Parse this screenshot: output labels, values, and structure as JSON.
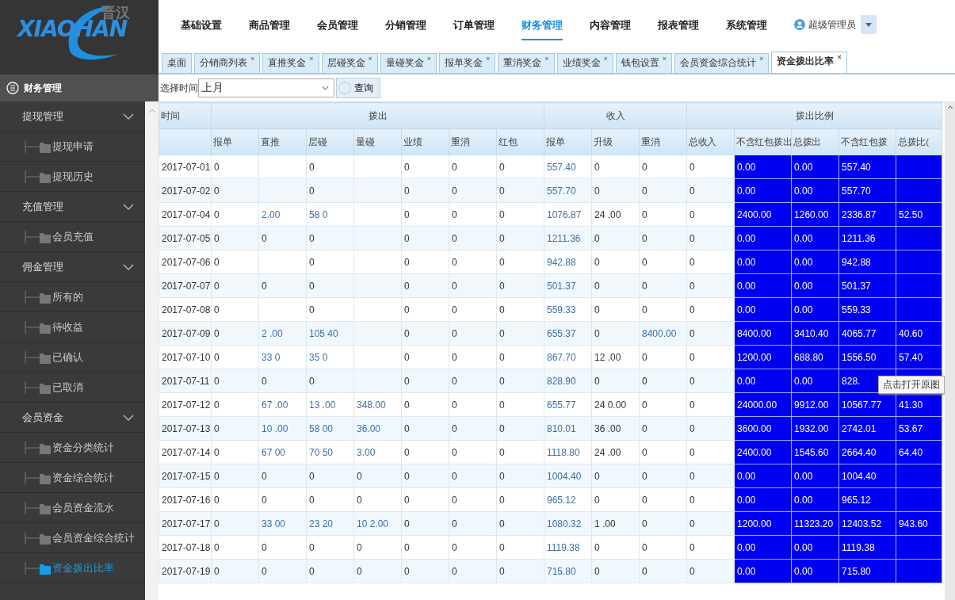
{
  "logo": {
    "text": "XIAOHAN",
    "subtext": "晋汉"
  },
  "nav": [
    {
      "label": "基础设置",
      "selected": false
    },
    {
      "label": "商品管理",
      "selected": false
    },
    {
      "label": "会员管理",
      "selected": false
    },
    {
      "label": "分销管理",
      "selected": false
    },
    {
      "label": "订单管理",
      "selected": false
    },
    {
      "label": "财务管理",
      "selected": true
    },
    {
      "label": "内容管理",
      "selected": false
    },
    {
      "label": "报表管理",
      "selected": false
    },
    {
      "label": "系统管理",
      "selected": false
    }
  ],
  "user": {
    "name": "超级管理员"
  },
  "tabs": [
    {
      "label": "桌面",
      "selected": false
    },
    {
      "label": "分销商列表",
      "close": "×",
      "selected": false
    },
    {
      "label": "直推奖金",
      "close": "×",
      "selected": false
    },
    {
      "label": "层碰奖金",
      "close": "×",
      "selected": false
    },
    {
      "label": "量碰奖金",
      "close": "×",
      "selected": false
    },
    {
      "label": "报单奖金",
      "close": "×",
      "selected": false
    },
    {
      "label": "重消奖金",
      "close": "×",
      "selected": false
    },
    {
      "label": "业绩奖金",
      "close": "×",
      "selected": false
    },
    {
      "label": "钱包设置",
      "close": "×",
      "selected": false
    },
    {
      "label": "会员资金综合统计",
      "close": "×",
      "selected": false
    },
    {
      "label": "资金拨出比率",
      "close": "×",
      "selected": true
    }
  ],
  "sidebar": {
    "title": "财务管理",
    "groups": [
      {
        "label": "提现管理",
        "expanded": true,
        "children": [
          {
            "label": "提现申请",
            "selected": false
          },
          {
            "label": "提现历史",
            "selected": false
          }
        ]
      },
      {
        "label": "充值管理",
        "expanded": true,
        "children": [
          {
            "label": "会员充值",
            "selected": false
          }
        ]
      },
      {
        "label": "佣金管理",
        "expanded": true,
        "children": [
          {
            "label": "所有的",
            "selected": false
          },
          {
            "label": "待收益",
            "selected": false
          },
          {
            "label": "已确认",
            "selected": false
          },
          {
            "label": "已取消",
            "selected": false
          }
        ]
      },
      {
        "label": "会员资金",
        "expanded": true,
        "children": [
          {
            "label": "资金分类统计",
            "selected": false
          },
          {
            "label": "资金综合统计",
            "selected": false
          },
          {
            "label": "会员资金流水",
            "selected": false
          },
          {
            "label": "会员资金综合统计",
            "selected": false
          },
          {
            "label": "资金拨出比率",
            "selected": true
          }
        ]
      }
    ]
  },
  "filter": {
    "label": "选择时间",
    "select": "上月",
    "button": "查询"
  },
  "table": {
    "groups": [
      {
        "label": "时间",
        "columns": [
          {
            "highlight": false
          }
        ]
      },
      {
        "label": "拨出",
        "columns": [
          {
            "label": "报单",
            "highlight": false
          },
          {
            "label": "直推",
            "highlight": false
          },
          {
            "label": "层碰",
            "highlight": false
          },
          {
            "label": "量碰",
            "highlight": false
          },
          {
            "label": "业绩",
            "highlight": false
          },
          {
            "label": "重消",
            "highlight": false
          },
          {
            "label": "红包",
            "highlight": false
          }
        ]
      },
      {
        "label": "收入",
        "columns": [
          {
            "label": "报单",
            "highlight": false
          },
          {
            "label": "升级",
            "highlight": false
          },
          {
            "label": "重消",
            "highlight": false
          }
        ]
      },
      {
        "label": "拨出比例",
        "columns": [
          {
            "label": "总收入",
            "highlight": false
          },
          {
            "label": "不含红包拨出",
            "highlight": true
          },
          {
            "label": "总拨出",
            "highlight": true
          },
          {
            "label": "不含红包拨",
            "highlight": true
          },
          {
            "label": "总拨比(",
            "highlight": true
          }
        ]
      }
    ],
    "rows": [
      {
        "cells": [
          "2017-07-01",
          "0",
          null,
          "0",
          null,
          "0",
          "0",
          "0",
          {
            "text": "557.40",
            "link": true
          },
          "0",
          "0",
          "0",
          "0.00",
          "0.00",
          "557.40",
          null
        ]
      },
      {
        "cells": [
          "2017-07-02",
          "0",
          null,
          "0",
          null,
          "0",
          "0",
          "0",
          {
            "text": "557.70",
            "link": true
          },
          "0",
          "0",
          "0",
          "0.00",
          "0.00",
          "557.70",
          null
        ]
      },
      {
        "cells": [
          "2017-07-04",
          "0",
          {
            "text": "2.00",
            "link": true
          },
          {
            "text": "58 0",
            "link": true
          },
          null,
          "0",
          "0",
          "0",
          {
            "text": "1076.87",
            "link": true
          },
          "24 .00",
          "0",
          "0",
          "2400.00",
          "1260.00",
          "2336.87",
          "52.50"
        ]
      },
      {
        "cells": [
          "2017-07-05",
          "0",
          "0",
          "0",
          null,
          "0",
          "0",
          "0",
          {
            "text": "1211.36",
            "link": true
          },
          "0",
          "0",
          "0",
          "0.00",
          "0.00",
          "1211.36",
          null
        ]
      },
      {
        "cells": [
          "2017-07-06",
          "0",
          null,
          "0",
          null,
          "0",
          "0",
          "0",
          {
            "text": "942.88",
            "link": true
          },
          "0",
          "0",
          "0",
          "0.00",
          "0.00",
          "942.88",
          null
        ]
      },
      {
        "cells": [
          "2017-07-07",
          "0",
          "0",
          "0",
          null,
          "0",
          "0",
          "0",
          {
            "text": "501.37",
            "link": true
          },
          "0",
          "0",
          "0",
          "0.00",
          "0.00",
          "501.37",
          null
        ]
      },
      {
        "cells": [
          "2017-07-08",
          "0",
          null,
          "0",
          null,
          "0",
          "0",
          "0",
          {
            "text": "559.33",
            "link": true
          },
          "0",
          "0",
          "0",
          "0.00",
          "0.00",
          "559.33",
          null
        ]
      },
      {
        "cells": [
          "2017-07-09",
          "0",
          {
            "text": "2 .00",
            "link": true
          },
          {
            "text": "105 40",
            "link": true
          },
          null,
          "0",
          "0",
          "0",
          {
            "text": "655.37",
            "link": true
          },
          "0",
          {
            "text": "8400.00",
            "link": true
          },
          "0",
          "8400.00",
          "3410.40",
          "4065.77",
          "40.60"
        ]
      },
      {
        "cells": [
          "2017-07-10",
          "0",
          {
            "text": "33 0",
            "link": true
          },
          {
            "text": "35 0",
            "link": true
          },
          null,
          "0",
          "0",
          "0",
          {
            "text": "867.70",
            "link": true
          },
          "12 .00",
          "0",
          "0",
          "1200.00",
          "688.80",
          "1556.50",
          "57.40"
        ]
      },
      {
        "cells": [
          "2017-07-11",
          "0",
          "0",
          "0",
          null,
          "0",
          "0",
          "0",
          {
            "text": "828.90",
            "link": true
          },
          "0",
          "0",
          "0",
          "0.00",
          "0.00",
          "828.",
          null
        ]
      },
      {
        "cells": [
          "2017-07-12",
          "0",
          {
            "text": "67 .00",
            "link": true
          },
          {
            "text": "13 .00",
            "link": true
          },
          {
            "text": "348.00",
            "link": true
          },
          "0",
          "0",
          "0",
          {
            "text": "655.77",
            "link": true
          },
          "24 0.00",
          "0",
          "0",
          "24000.00",
          "9912.00",
          "10567.77",
          "41.30"
        ]
      },
      {
        "cells": [
          "2017-07-13",
          "0",
          {
            "text": "10 .00",
            "link": true
          },
          {
            "text": "58 00",
            "link": true
          },
          {
            "text": "36.00",
            "link": true
          },
          "0",
          "0",
          "0",
          {
            "text": "810.01",
            "link": true
          },
          "36 .00",
          "0",
          "0",
          "3600.00",
          "1932.00",
          "2742.01",
          "53.67"
        ]
      },
      {
        "cells": [
          "2017-07-14",
          "0",
          {
            "text": "67 00",
            "link": true
          },
          {
            "text": "70 50",
            "link": true
          },
          {
            "text": "3.00",
            "link": true
          },
          "0",
          "0",
          "0",
          {
            "text": "1118.80",
            "link": true
          },
          "24 .00",
          "0",
          "0",
          "2400.00",
          "1545.60",
          "2664.40",
          "64.40"
        ]
      },
      {
        "cells": [
          "2017-07-15",
          "0",
          "0",
          "0",
          "0",
          "0",
          "0",
          "0",
          {
            "text": "1004.40",
            "link": true
          },
          "0",
          "0",
          "0",
          "0.00",
          "0.00",
          "1004.40",
          null
        ]
      },
      {
        "cells": [
          "2017-07-16",
          "0",
          "0",
          "0",
          "0",
          "0",
          "0",
          "0",
          {
            "text": "965.12",
            "link": true
          },
          "0",
          "0",
          "0",
          "0.00",
          "0.00",
          "965.12",
          null
        ]
      },
      {
        "cells": [
          "2017-07-17",
          "0",
          {
            "text": "33 00",
            "link": true
          },
          {
            "text": "23 20",
            "link": true
          },
          {
            "text": "10 2.00",
            "link": true
          },
          "0",
          "0",
          "0",
          {
            "text": "1080.32",
            "link": true
          },
          "1 .00",
          "0",
          "0",
          "1200.00",
          "11323.20",
          "12403.52",
          "943.60"
        ]
      },
      {
        "cells": [
          "2017-07-18",
          "0",
          "0",
          "0",
          "0",
          "0",
          "0",
          "0",
          {
            "text": "1119.38",
            "link": true
          },
          "0",
          "0",
          "0",
          "0.00",
          "0.00",
          "1119.38",
          null
        ]
      },
      {
        "cells": [
          "2017-07-19",
          "0",
          "0",
          "0",
          "0",
          "0",
          "0",
          "0",
          {
            "text": "715.80",
            "link": true
          },
          "0",
          "0",
          "0",
          "0.00",
          "0.00",
          "715.80",
          null
        ]
      }
    ],
    "tooltip": {
      "text": "点击打开原图"
    }
  }
}
